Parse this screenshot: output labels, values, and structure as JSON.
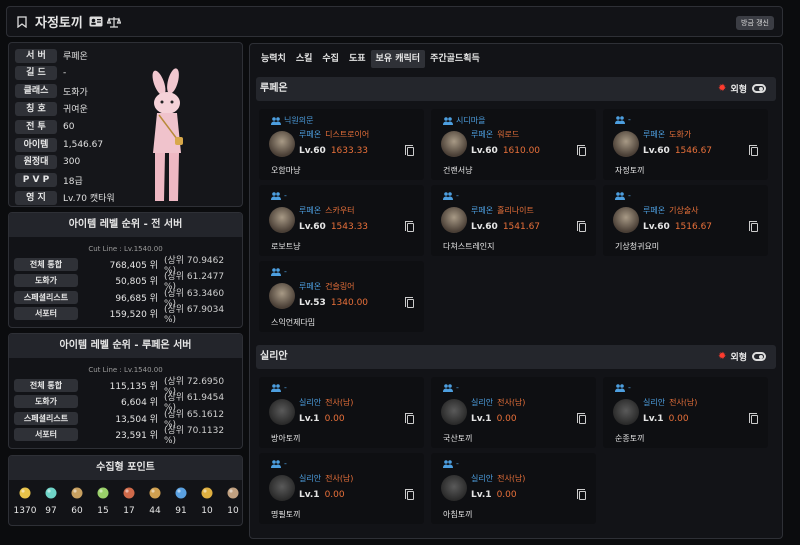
{
  "header": {
    "title": "자정토끼",
    "refresh_label": "방금 갱신"
  },
  "profile": {
    "rows": [
      {
        "label": "서 버",
        "value": "루페온"
      },
      {
        "label": "길 드",
        "value": "-"
      },
      {
        "label": "클래스",
        "value": "도화가"
      },
      {
        "label": "칭 호",
        "value": "귀여운"
      },
      {
        "label": "전 투",
        "value": "60"
      },
      {
        "label": "아이템",
        "value": "1,546.67"
      },
      {
        "label": "원정대",
        "value": "300"
      },
      {
        "label": "P V P",
        "value": "18급"
      },
      {
        "label": "영 지",
        "value": "Lv.70 캣타워"
      }
    ]
  },
  "rank_all": {
    "title": "아이템 레벨 순위 - 전 서버",
    "cutline": "Cut Line : Lv.1540.00",
    "rows": [
      {
        "label": "전체 통합",
        "rank": "768,405 위",
        "pct": "(상위 70.9462 %)"
      },
      {
        "label": "도화가",
        "rank": "50,805 위",
        "pct": "(상위 61.2477 %)"
      },
      {
        "label": "스페셜리스트",
        "rank": "96,685 위",
        "pct": "(상위 63.3460 %)"
      },
      {
        "label": "서포터",
        "rank": "159,520 위",
        "pct": "(상위 67.9034 %)"
      }
    ]
  },
  "rank_server": {
    "title": "아이템 레벨 순위 - 루페온 서버",
    "cutline": "Cut Line : Lv.1540.00",
    "rows": [
      {
        "label": "전체 통합",
        "rank": "115,135 위",
        "pct": "(상위 72.6950 %)"
      },
      {
        "label": "도화가",
        "rank": "6,604 위",
        "pct": "(상위 61.9454 %)"
      },
      {
        "label": "스페셜리스트",
        "rank": "13,504 위",
        "pct": "(상위 65.1612 %)"
      },
      {
        "label": "서포터",
        "rank": "23,591 위",
        "pct": "(상위 70.1132 %)"
      }
    ]
  },
  "collect": {
    "title": "수집형 포인트",
    "items": [
      {
        "icon": "island-heart-icon",
        "value": "1370",
        "color": "#e8c34a"
      },
      {
        "icon": "orb-icon",
        "value": "97",
        "color": "#6fd4c8"
      },
      {
        "icon": "painting-icon",
        "value": "60",
        "color": "#c8a060"
      },
      {
        "icon": "mokoko-icon",
        "value": "15",
        "color": "#9ad06a"
      },
      {
        "icon": "giant-heart-icon",
        "value": "17",
        "color": "#d06a4a"
      },
      {
        "icon": "seed-icon",
        "value": "44",
        "color": "#d0a050"
      },
      {
        "icon": "leaf-icon",
        "value": "91",
        "color": "#5aa0e0"
      },
      {
        "icon": "star-icon",
        "value": "10",
        "color": "#e0b040"
      },
      {
        "icon": "medal-icon",
        "value": "10",
        "color": "#c0a080"
      }
    ]
  },
  "tabs": [
    "능력치",
    "스킬",
    "수집",
    "도표",
    "보유 캐릭터",
    "주간골드획득"
  ],
  "active_tab": 4,
  "servers": [
    {
      "name": "루페온",
      "looks_label": "외형",
      "characters": [
        {
          "guild": "닉원의문",
          "server": "루페온",
          "class": "디스트로이어",
          "level": "Lv.60",
          "item": "1633.33",
          "name": "오함마냥"
        },
        {
          "guild": "시디마을",
          "server": "루페온",
          "class": "워로드",
          "level": "Lv.60",
          "item": "1610.00",
          "name": "건랜서냥"
        },
        {
          "guild": "-",
          "server": "루페온",
          "class": "도화가",
          "level": "Lv.60",
          "item": "1546.67",
          "name": "자정토끼"
        },
        {
          "guild": "-",
          "server": "루페온",
          "class": "스카우터",
          "level": "Lv.60",
          "item": "1543.33",
          "name": "로보트냥"
        },
        {
          "guild": "-",
          "server": "루페온",
          "class": "홀리나이트",
          "level": "Lv.60",
          "item": "1541.67",
          "name": "다쳐스트레인지"
        },
        {
          "guild": "-",
          "server": "루페온",
          "class": "기상술사",
          "level": "Lv.60",
          "item": "1516.67",
          "name": "기상청귀요미"
        },
        {
          "guild": "-",
          "server": "루페온",
          "class": "건슬링어",
          "level": "Lv.53",
          "item": "1340.00",
          "name": "스익언제다밈"
        }
      ]
    },
    {
      "name": "실리안",
      "looks_label": "외형",
      "characters": [
        {
          "guild": "-",
          "server": "실리안",
          "class": "전사(남)",
          "level": "Lv.1",
          "item": "0.00",
          "name": "방아토끼"
        },
        {
          "guild": "-",
          "server": "실리안",
          "class": "전사(남)",
          "level": "Lv.1",
          "item": "0.00",
          "name": "국산토끼"
        },
        {
          "guild": "-",
          "server": "실리안",
          "class": "전사(남)",
          "level": "Lv.1",
          "item": "0.00",
          "name": "순종토끼"
        },
        {
          "guild": "-",
          "server": "실리안",
          "class": "전사(남)",
          "level": "Lv.1",
          "item": "0.00",
          "name": "명필토끼"
        },
        {
          "guild": "-",
          "server": "실리안",
          "class": "전사(남)",
          "level": "Lv.1",
          "item": "0.00",
          "name": "아침토끼"
        }
      ]
    }
  ]
}
